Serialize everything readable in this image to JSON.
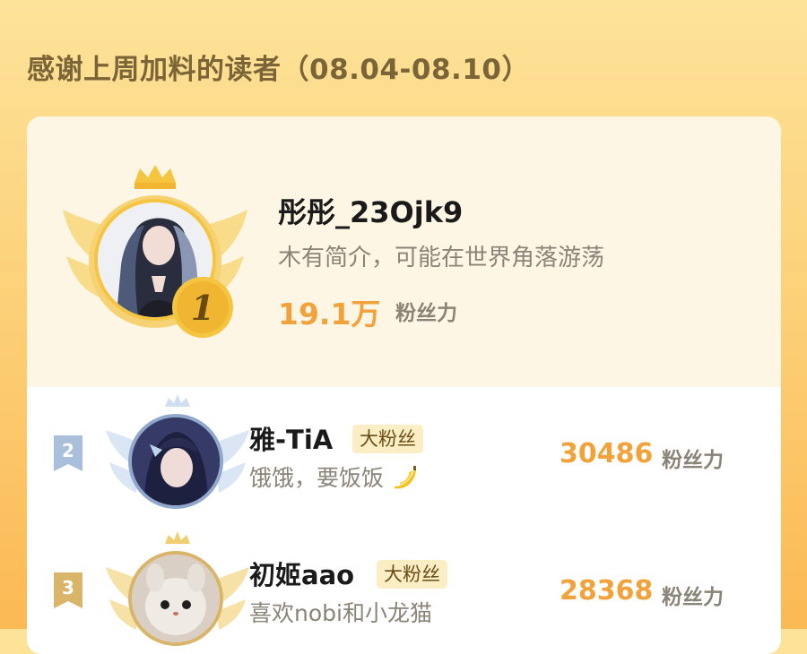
{
  "page": {
    "title": "感谢上周加料的读者（08.04-08.10）"
  },
  "ranking": [
    {
      "rank": "1",
      "name": "彤彤_23Ojk9",
      "description": "木有简介，可能在世界角落游荡",
      "score": "19.1万",
      "score_unit": "粉丝力",
      "badge": ""
    },
    {
      "rank": "2",
      "name": "雅-TiA",
      "badge": "大粉丝",
      "description": "饿饿，要饭饭",
      "description_emoji": "banana-icon",
      "score": "30486",
      "score_unit": "粉丝力"
    },
    {
      "rank": "3",
      "name": "初姬aao",
      "badge": "大粉丝",
      "description": "喜欢nobi和小龙猫",
      "score": "28368",
      "score_unit": "粉丝力"
    }
  ],
  "colors": {
    "score": "#f2a23a",
    "gold": "#f5c542",
    "silver": "#a9bfdc",
    "bronze": "#d9b56a"
  }
}
